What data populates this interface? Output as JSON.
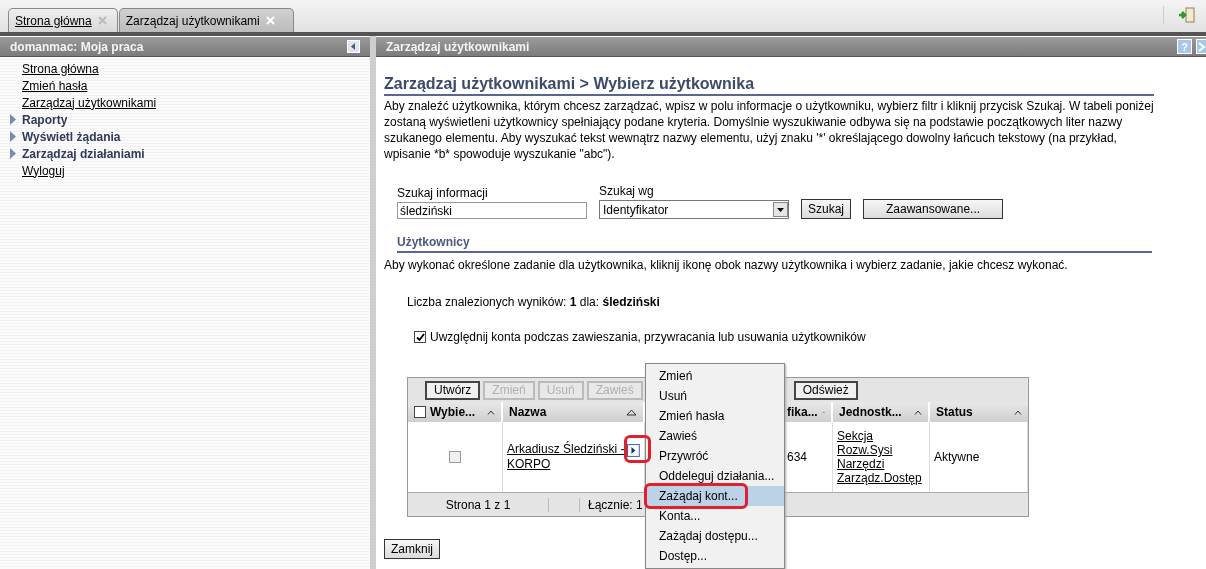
{
  "tabs": [
    {
      "label": "Strona główna",
      "selected": false
    },
    {
      "label": "Zarządzaj użytkownikami",
      "selected": true
    }
  ],
  "left_panel": {
    "title": "domanmac: Moja praca",
    "items": [
      {
        "label": "Strona główna",
        "kind": "link"
      },
      {
        "label": "Zmień hasła",
        "kind": "link"
      },
      {
        "label": "Zarządzaj użytkownikami",
        "kind": "link"
      },
      {
        "label": "Raporty",
        "kind": "group",
        "expanded": false
      },
      {
        "label": "Wyświetl żądania",
        "kind": "group",
        "expanded": false
      },
      {
        "label": "Zarządzaj działaniami",
        "kind": "group",
        "expanded": false
      },
      {
        "label": "Wyloguj",
        "kind": "link"
      }
    ]
  },
  "main_panel": {
    "title": "Zarządzaj użytkownikami",
    "help_button": "?",
    "heading": "Zarządzaj użytkownikami > Wybierz użytkownika",
    "intro": "Aby znaleźć użytkownika, którym chcesz zarządzać, wpisz w polu informacje o użytkowniku, wybierz filtr i kliknij przycisk Szukaj. W tabeli poniżej zostaną wyświetleni użytkownicy spełniający podane kryteria. Domyślnie wyszukiwanie odbywa się na podstawie początkowych liter nazwy szukanego elementu. Aby wyszukać tekst wewnątrz nazwy elementu, użyj znaku '*' określającego dowolny łańcuch tekstowy (na przykład, wpisanie *b* spowoduje wyszukanie \"abc\").",
    "search": {
      "info_label": "Szukaj informacji",
      "info_value": "śledziński",
      "by_label": "Szukaj wg",
      "by_value": "Identyfikator",
      "buttons": [
        "Szukaj",
        "Zaawansowane..."
      ]
    },
    "users": {
      "title": "Użytkownicy",
      "hint": "Aby wykonać określone zadanie dla użytkownika, kliknij ikonę obok nazwy użytkownika i wybierz zadanie, jakie chcesz wykonać.",
      "result_text": "Liczba znalezionych wyników: **1** dla: **śledziński**",
      "include_accounts": {
        "label": "Uwzględnij konta podczas zawieszania, przywracania lub usuwania użytkowników",
        "checked": true
      },
      "toolbar": [
        {
          "label": "Utwórz",
          "disabled": false
        },
        {
          "label": "Zmień",
          "disabled": true
        },
        {
          "label": "Usuń",
          "disabled": true
        },
        {
          "label": "Zawieś",
          "disabled": true
        },
        {
          "label": "Odśwież",
          "disabled": false
        }
      ],
      "table": {
        "select_all_checked": false,
        "columns": [
          {
            "label": "Wybie...",
            "kind": "select"
          },
          {
            "label": "Nazwa",
            "kind": "name"
          },
          {
            "label": "fika...",
            "kind": "id"
          },
          {
            "label": "Jednostk...",
            "kind": "unit"
          },
          {
            "label": "Status",
            "kind": "status"
          }
        ],
        "rows": [
          {
            "selected": false,
            "name": "Arkadiusz Śledziński - KORPO",
            "id": "634",
            "unit": "Sekcja Rozw.Sysi Narzędzi Zarządz.Dostęp",
            "status": "Aktywne"
          }
        ],
        "footer": [
          "Strona 1 z 1",
          "Łącznie: 1"
        ]
      },
      "context_menu": [
        {
          "label": "Zmień",
          "selected": false
        },
        {
          "label": "Usuń",
          "selected": false
        },
        {
          "label": "Zmień hasła",
          "selected": false
        },
        {
          "label": "Zawieś",
          "selected": false
        },
        {
          "label": "Przywróć",
          "selected": false
        },
        {
          "label": "Oddeleguj działania...",
          "selected": false
        },
        {
          "label": "Zażądaj kont...",
          "selected": true
        },
        {
          "label": "Konta...",
          "selected": false
        },
        {
          "label": "Zażądaj dostępu...",
          "selected": false
        },
        {
          "label": "Dostęp...",
          "selected": false
        }
      ]
    },
    "close_button": "Zamknij"
  }
}
